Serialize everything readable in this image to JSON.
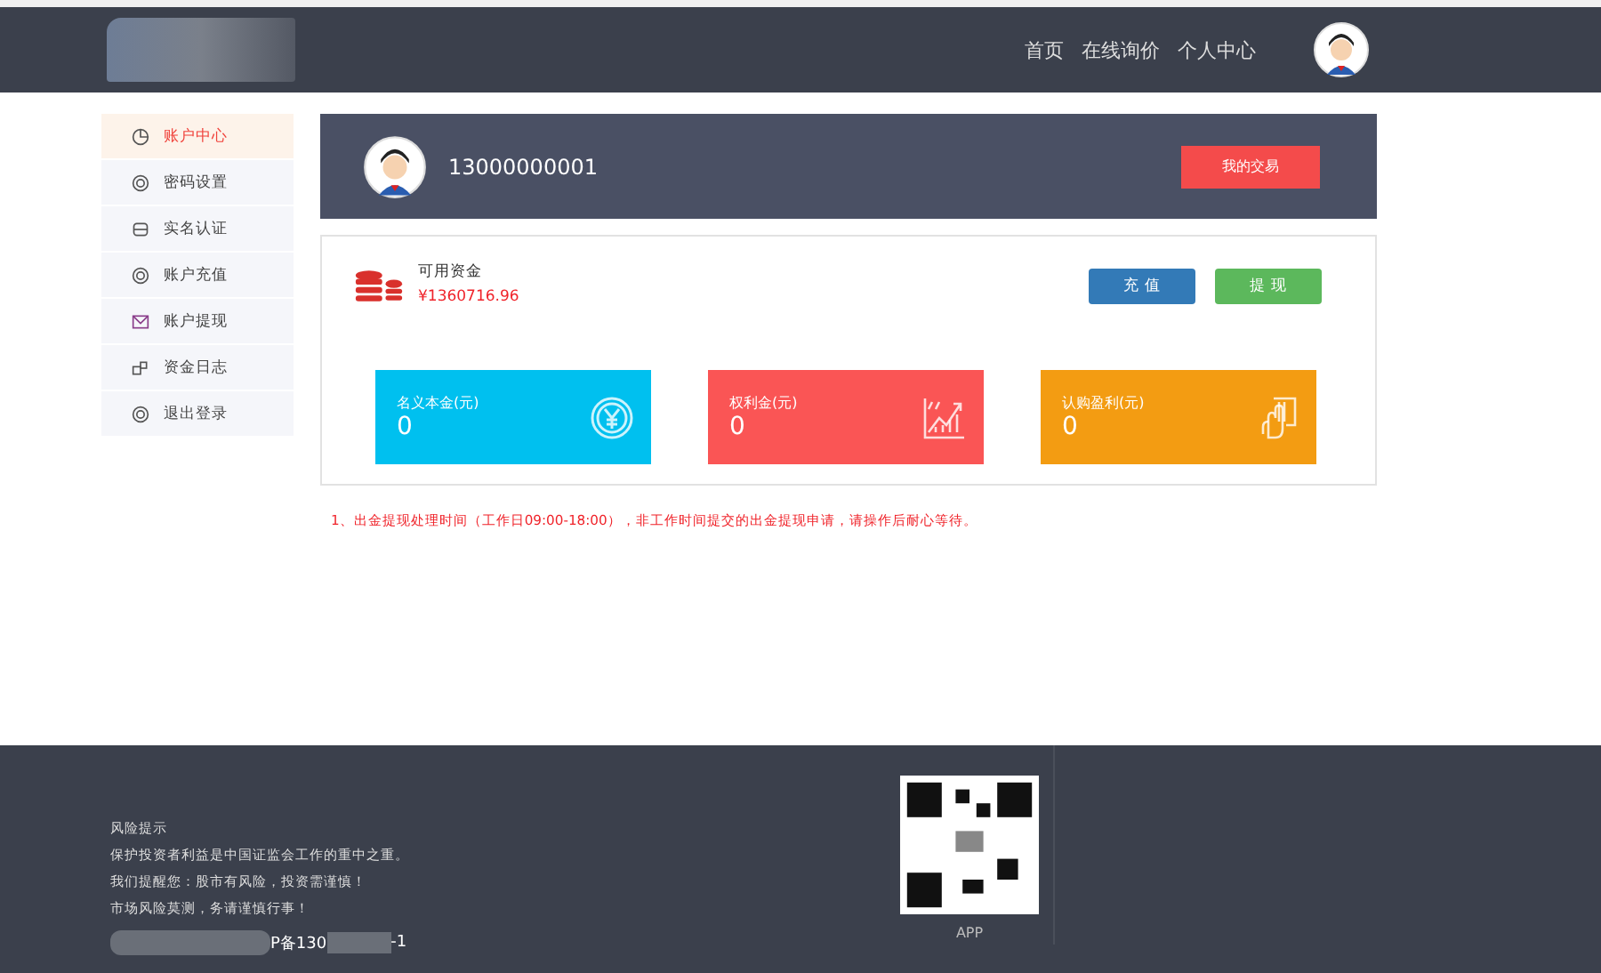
{
  "nav": {
    "links": [
      "首页",
      "在线询价",
      "个人中心"
    ]
  },
  "sidebar": {
    "items": [
      {
        "label": "账户中心",
        "selected": true
      },
      {
        "label": "密码设置",
        "selected": false
      },
      {
        "label": "实名认证",
        "selected": false
      },
      {
        "label": "账户充值",
        "selected": false
      },
      {
        "label": "账户提现",
        "selected": false
      },
      {
        "label": "资金日志",
        "selected": false
      },
      {
        "label": "退出登录",
        "selected": false
      }
    ]
  },
  "profile": {
    "phone": "13000000001",
    "button": "我的交易"
  },
  "funds": {
    "label": "可用资金",
    "amount": "¥1360716.96",
    "buttons": [
      {
        "label": "充 值",
        "color": "#337ab7"
      },
      {
        "label": "提 现",
        "color": "#5cb85c"
      }
    ]
  },
  "stats": [
    {
      "label": "名义本金(元)",
      "value": "0",
      "color": "#00c0ef"
    },
    {
      "label": "权利金(元)",
      "value": "0",
      "color": "#fa5555"
    },
    {
      "label": "认购盈利(元)",
      "value": "0",
      "color": "#f39c12"
    }
  ],
  "notice": "1、出金提现处理时间（工作日09:00-18:00），非工作时间提交的出金提现申请，请操作后耐心等待。",
  "footer": {
    "title": "风险提示",
    "lines": [
      "保护投资者利益是中国证监会工作的重中之重。",
      "我们提醒您：股市有风险，投资需谨慎！",
      "市场风险莫测，务请谨慎行事！"
    ],
    "icp": [
      "P备130",
      "-1"
    ],
    "qr_caption": "APP"
  }
}
